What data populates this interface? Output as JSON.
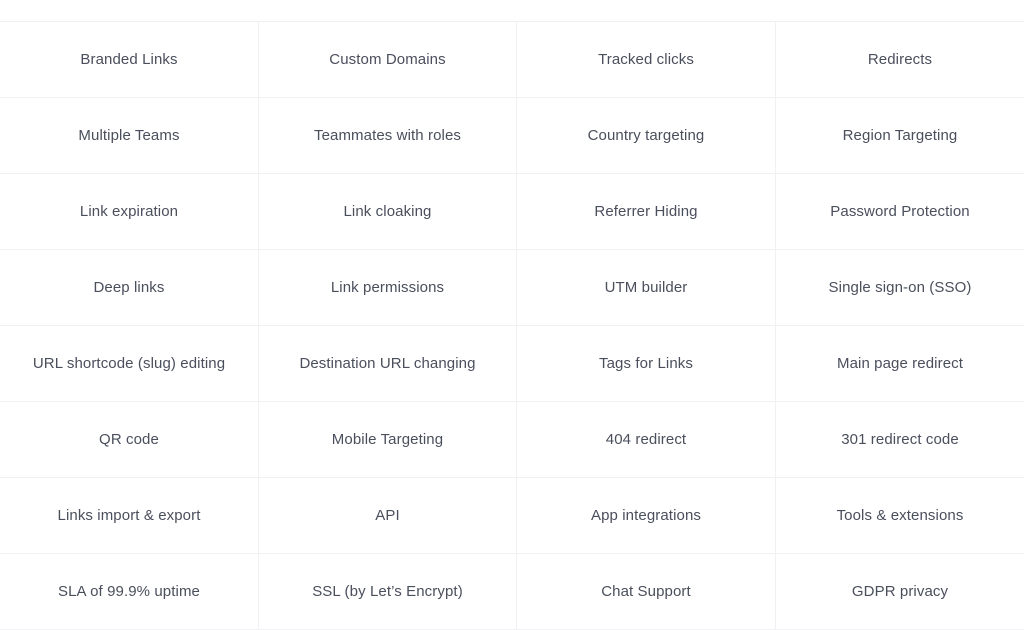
{
  "page": {
    "background_color": "#ffffff",
    "border_color": "#f1f1f3",
    "text_color": "#4a4f5c"
  },
  "feature_grid": {
    "columns": 4,
    "rows": 8,
    "cells": [
      "Branded Links",
      "Custom Domains",
      "Tracked clicks",
      "Redirects",
      "Multiple Teams",
      "Teammates with roles",
      "Country targeting",
      "Region Targeting",
      "Link expiration",
      "Link cloaking",
      "Referrer Hiding",
      "Password Protection",
      "Deep links",
      "Link permissions",
      "UTM builder",
      "Single sign-on (SSO)",
      "URL shortcode (slug) editing",
      "Destination URL changing",
      "Tags for Links",
      "Main page redirect",
      "QR code",
      "Mobile Targeting",
      "404 redirect",
      "301 redirect code",
      "Links import & export",
      "API",
      "App integrations",
      "Tools & extensions",
      "SLA of 99.9% uptime",
      "SSL (by Let’s Encrypt)",
      "Chat Support",
      "GDPR privacy"
    ]
  }
}
